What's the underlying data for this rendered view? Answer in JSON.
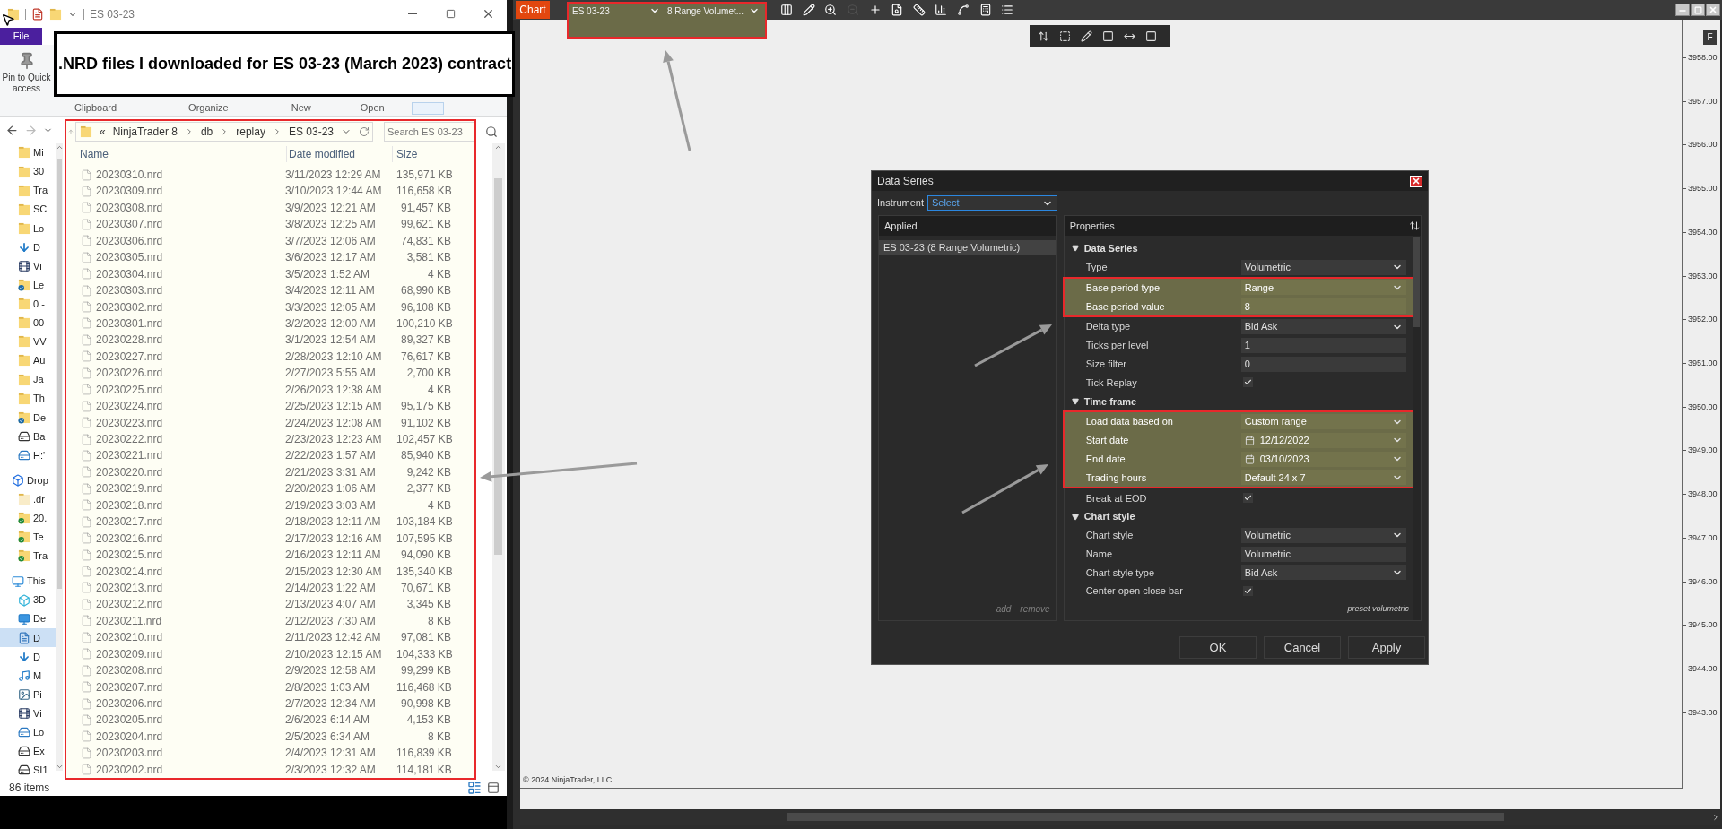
{
  "explorer": {
    "title": "ES 03-23",
    "file_tab": "File",
    "pin_button": "Pin to Quick access",
    "ribbon_groups": [
      "Clipboard",
      "Organize",
      "New",
      "Open"
    ],
    "address_prefix": "«",
    "address_path": [
      "NinjaTrader 8",
      "db",
      "replay",
      "ES 03-23"
    ],
    "search": {
      "placeholder": "Search ES 03-23"
    },
    "nav": [
      {
        "label": "Mi",
        "kind": "folder",
        "selected": false
      },
      {
        "label": "30",
        "kind": "folder",
        "selected": false
      },
      {
        "label": "Tra",
        "kind": "folder",
        "selected": false
      },
      {
        "label": "SC",
        "kind": "folder",
        "selected": false
      },
      {
        "label": "Lo",
        "kind": "folder",
        "selected": false
      },
      {
        "label": "D",
        "kind": "download",
        "selected": false
      },
      {
        "label": "Vi",
        "kind": "video",
        "selected": false
      },
      {
        "label": "Le",
        "kind": "folder-cloud",
        "selected": false
      },
      {
        "label": "0 -",
        "kind": "folder",
        "selected": false
      },
      {
        "label": "00",
        "kind": "folder",
        "selected": false
      },
      {
        "label": "VV",
        "kind": "folder",
        "selected": false
      },
      {
        "label": "Au",
        "kind": "folder",
        "selected": false
      },
      {
        "label": "Ja",
        "kind": "folder",
        "selected": false
      },
      {
        "label": "Th",
        "kind": "folder",
        "selected": false
      },
      {
        "label": "De",
        "kind": "folder-cloud",
        "selected": false
      },
      {
        "label": "Ba",
        "kind": "drive",
        "selected": false
      },
      {
        "label": "H:'",
        "kind": "network-drive",
        "selected": false
      },
      {
        "label": "Drop",
        "kind": "dropbox",
        "selected": false,
        "children": [
          {
            "label": ".dr",
            "kind": "folder-pale",
            "selected": false
          },
          {
            "label": "20.",
            "kind": "folder-synced",
            "selected": false
          },
          {
            "label": "Te",
            "kind": "folder-synced",
            "selected": false
          },
          {
            "label": "Tra",
            "kind": "folder-synced",
            "selected": false
          }
        ]
      },
      {
        "label": "This",
        "kind": "pc",
        "selected": false,
        "children": [
          {
            "label": "3D",
            "kind": "cube",
            "selected": false
          },
          {
            "label": "De",
            "kind": "desktop",
            "selected": false
          },
          {
            "label": "D",
            "kind": "document",
            "selected": true
          },
          {
            "label": "D",
            "kind": "download",
            "selected": false
          },
          {
            "label": "M",
            "kind": "music",
            "selected": false
          },
          {
            "label": "Pi",
            "kind": "pictures",
            "selected": false
          },
          {
            "label": "Vi",
            "kind": "video",
            "selected": false
          },
          {
            "label": "Lo",
            "kind": "network-drive",
            "selected": false
          },
          {
            "label": "Ex",
            "kind": "drive",
            "selected": false
          },
          {
            "label": "SI1",
            "kind": "drive",
            "selected": false
          }
        ]
      }
    ],
    "columns": [
      "Name",
      "Date modified",
      "Size"
    ],
    "rows": [
      {
        "name": "20230310.nrd",
        "date": "3/11/2023 12:29 AM",
        "size": "135,971 KB"
      },
      {
        "name": "20230309.nrd",
        "date": "3/10/2023 12:44 AM",
        "size": "116,658 KB"
      },
      {
        "name": "20230308.nrd",
        "date": "3/9/2023 12:21 AM",
        "size": "91,457 KB"
      },
      {
        "name": "20230307.nrd",
        "date": "3/8/2023 12:25 AM",
        "size": "99,621 KB"
      },
      {
        "name": "20230306.nrd",
        "date": "3/7/2023 12:06 AM",
        "size": "74,831 KB"
      },
      {
        "name": "20230305.nrd",
        "date": "3/6/2023 12:17 AM",
        "size": "3,581 KB"
      },
      {
        "name": "20230304.nrd",
        "date": "3/5/2023 1:52 AM",
        "size": "4 KB"
      },
      {
        "name": "20230303.nrd",
        "date": "3/4/2023 12:11 AM",
        "size": "68,990 KB"
      },
      {
        "name": "20230302.nrd",
        "date": "3/3/2023 12:05 AM",
        "size": "96,108 KB"
      },
      {
        "name": "20230301.nrd",
        "date": "3/2/2023 12:00 AM",
        "size": "100,210 KB"
      },
      {
        "name": "20230228.nrd",
        "date": "3/1/2023 12:54 AM",
        "size": "89,327 KB"
      },
      {
        "name": "20230227.nrd",
        "date": "2/28/2023 12:10 AM",
        "size": "76,617 KB"
      },
      {
        "name": "20230226.nrd",
        "date": "2/27/2023 5:55 AM",
        "size": "2,700 KB"
      },
      {
        "name": "20230225.nrd",
        "date": "2/26/2023 12:38 AM",
        "size": "4 KB"
      },
      {
        "name": "20230224.nrd",
        "date": "2/25/2023 12:15 AM",
        "size": "95,175 KB"
      },
      {
        "name": "20230223.nrd",
        "date": "2/24/2023 12:08 AM",
        "size": "91,102 KB"
      },
      {
        "name": "20230222.nrd",
        "date": "2/23/2023 12:23 AM",
        "size": "102,457 KB"
      },
      {
        "name": "20230221.nrd",
        "date": "2/22/2023 1:57 AM",
        "size": "85,940 KB"
      },
      {
        "name": "20230220.nrd",
        "date": "2/21/2023 3:31 AM",
        "size": "9,242 KB"
      },
      {
        "name": "20230219.nrd",
        "date": "2/20/2023 1:06 AM",
        "size": "2,377 KB"
      },
      {
        "name": "20230218.nrd",
        "date": "2/19/2023 3:03 AM",
        "size": "4 KB"
      },
      {
        "name": "20230217.nrd",
        "date": "2/18/2023 12:11 AM",
        "size": "103,184 KB"
      },
      {
        "name": "20230216.nrd",
        "date": "2/17/2023 12:16 AM",
        "size": "107,595 KB"
      },
      {
        "name": "20230215.nrd",
        "date": "2/16/2023 12:11 AM",
        "size": "94,090 KB"
      },
      {
        "name": "20230214.nrd",
        "date": "2/15/2023 12:30 AM",
        "size": "135,340 KB"
      },
      {
        "name": "20230213.nrd",
        "date": "2/14/2023 1:22 AM",
        "size": "70,671 KB"
      },
      {
        "name": "20230212.nrd",
        "date": "2/13/2023 4:07 AM",
        "size": "3,345 KB"
      },
      {
        "name": "20230211.nrd",
        "date": "2/12/2023 7:30 AM",
        "size": "8 KB"
      },
      {
        "name": "20230210.nrd",
        "date": "2/11/2023 12:42 AM",
        "size": "97,081 KB"
      },
      {
        "name": "20230209.nrd",
        "date": "2/10/2023 12:15 AM",
        "size": "104,333 KB"
      },
      {
        "name": "20230208.nrd",
        "date": "2/9/2023 12:58 AM",
        "size": "99,299 KB"
      },
      {
        "name": "20230207.nrd",
        "date": "2/8/2023 1:03 AM",
        "size": "116,468 KB"
      },
      {
        "name": "20230206.nrd",
        "date": "2/7/2023 12:34 AM",
        "size": "90,998 KB"
      },
      {
        "name": "20230205.nrd",
        "date": "2/6/2023 6:14 AM",
        "size": "4,153 KB"
      },
      {
        "name": "20230204.nrd",
        "date": "2/5/2023 6:34 AM",
        "size": "8 KB"
      },
      {
        "name": "20230203.nrd",
        "date": "2/4/2023 12:31 AM",
        "size": "116,839 KB"
      },
      {
        "name": "20230202.nrd",
        "date": "2/3/2023 12:32 AM",
        "size": "114,181 KB"
      }
    ],
    "status": "86 items"
  },
  "callout": ".NRD files I downloaded for ES 03-23 (March 2023) contract",
  "chart": {
    "tab": "Chart",
    "instrument": "ES 03-23",
    "period": "8 Range Volumet...",
    "toolbar": [
      {
        "kind": "bars",
        "disabled": false
      },
      {
        "kind": "pencil",
        "disabled": false
      },
      {
        "kind": "zoom-in",
        "disabled": false
      },
      {
        "kind": "zoom-out",
        "disabled": true
      },
      {
        "kind": "crosshair",
        "disabled": false
      },
      {
        "kind": "doc-search",
        "disabled": false
      },
      {
        "kind": "ruler",
        "disabled": false
      },
      {
        "kind": "bar-chart",
        "disabled": false
      },
      {
        "kind": "line-chart",
        "disabled": false
      },
      {
        "kind": "calculator",
        "disabled": false
      },
      {
        "kind": "list",
        "disabled": false
      }
    ],
    "draw_tools": [
      {
        "kind": "arrows"
      },
      {
        "kind": "dashed-rect"
      },
      {
        "kind": "pencil"
      },
      {
        "kind": "rect"
      },
      {
        "kind": "h-arrow"
      },
      {
        "kind": "rect"
      }
    ],
    "axis_button": "F",
    "axis_labels": [
      "3958.00",
      "3957.00",
      "3956.00",
      "3955.00",
      "3954.00",
      "3953.00",
      "3952.00",
      "3951.00",
      "3950.00",
      "3949.00",
      "3948.00",
      "3947.00",
      "3946.00",
      "3945.00",
      "3944.00",
      "3943.00"
    ],
    "copyright": "© 2024 NinjaTrader, LLC"
  },
  "dialog": {
    "title": "Data Series",
    "instrument_label": "Instrument",
    "instrument_value": "Select",
    "applied": {
      "title": "Applied",
      "items": [
        {
          "label": "ES 03-23 (8 Range Volumetric)",
          "selected": true
        }
      ],
      "actions": [
        {
          "label": "add",
          "disabled": true
        },
        {
          "label": "remove",
          "disabled": true
        }
      ]
    },
    "properties_title": "Properties",
    "sections": [
      {
        "title": "Data Series",
        "expanded": true,
        "rows": [
          {
            "label": "Type",
            "kind": "dropdown",
            "value": "Volumetric",
            "highlighted": false
          },
          {
            "label": "Base period type",
            "kind": "dropdown",
            "value": "Range",
            "highlighted": true
          },
          {
            "label": "Base period value",
            "kind": "text",
            "value": "8",
            "highlighted": true
          },
          {
            "label": "Delta type",
            "kind": "dropdown",
            "value": "Bid Ask",
            "highlighted": false
          },
          {
            "label": "Ticks per level",
            "kind": "text",
            "value": "1",
            "highlighted": false
          },
          {
            "label": "Size filter",
            "kind": "text",
            "value": "0",
            "highlighted": false
          },
          {
            "label": "Tick Replay",
            "kind": "checkbox",
            "checked": true,
            "highlighted": false
          }
        ]
      },
      {
        "title": "Time frame",
        "expanded": true,
        "rows": [
          {
            "label": "Load data based on",
            "kind": "dropdown",
            "value": "Custom range",
            "highlighted": true
          },
          {
            "label": "Start date",
            "kind": "date",
            "value": "12/12/2022",
            "highlighted": true
          },
          {
            "label": "End date",
            "kind": "date",
            "value": "03/10/2023",
            "highlighted": true
          },
          {
            "label": "Trading hours",
            "kind": "dropdown",
            "value": "Default 24 x 7",
            "highlighted": true
          },
          {
            "label": "Break at EOD",
            "kind": "checkbox",
            "checked": true,
            "highlighted": false
          }
        ]
      },
      {
        "title": "Chart style",
        "expanded": true,
        "rows": [
          {
            "label": "Chart style",
            "kind": "dropdown",
            "value": "Volumetric",
            "highlighted": false
          },
          {
            "label": "Name",
            "kind": "text",
            "value": "Volumetric",
            "highlighted": false
          },
          {
            "label": "Chart style type",
            "kind": "dropdown",
            "value": "Bid Ask",
            "highlighted": false
          },
          {
            "label": "Center open close bar",
            "kind": "checkbox",
            "checked": true,
            "highlighted": false
          }
        ]
      }
    ],
    "preset": "preset volumetric",
    "buttons": [
      "OK",
      "Cancel",
      "Apply"
    ]
  }
}
